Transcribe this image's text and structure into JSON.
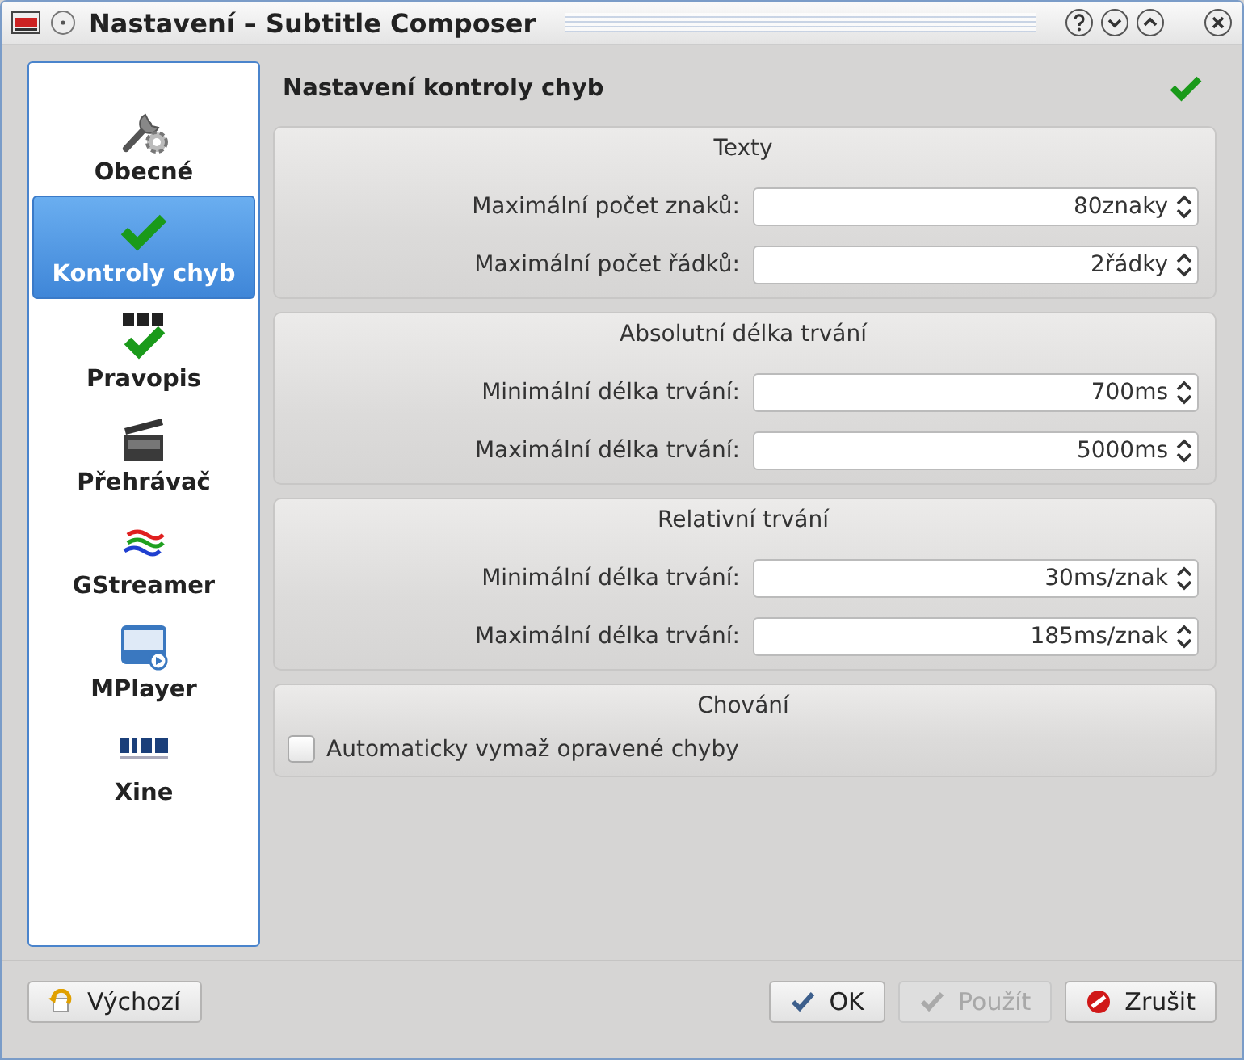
{
  "window": {
    "title": "Nastavení – Subtitle Composer"
  },
  "sidebar": {
    "items": [
      {
        "label": "Obecné",
        "kind": "tools",
        "selected": false
      },
      {
        "label": "Kontroly chyb",
        "kind": "check",
        "selected": true
      },
      {
        "label": "Pravopis",
        "kind": "spelling",
        "selected": false
      },
      {
        "label": "Přehrávač",
        "kind": "clapper",
        "selected": false
      },
      {
        "label": "GStreamer",
        "kind": "waves",
        "selected": false
      },
      {
        "label": "MPlayer",
        "kind": "screen",
        "selected": false
      },
      {
        "label": "Xine",
        "kind": "blocks",
        "selected": false
      }
    ]
  },
  "page": {
    "title": "Nastavení kontroly chyb"
  },
  "groups": [
    {
      "title": "Texty",
      "rows": [
        {
          "kind": "spinbox",
          "label": "Maximální počet znaků:",
          "value": "80znaky"
        },
        {
          "kind": "spinbox",
          "label": "Maximální počet řádků:",
          "value": "2řádky"
        }
      ]
    },
    {
      "title": "Absolutní délka trvání",
      "rows": [
        {
          "kind": "spinbox",
          "label": "Minimální délka trvání:",
          "value": "700ms"
        },
        {
          "kind": "spinbox",
          "label": "Maximální délka trvání:",
          "value": "5000ms"
        }
      ]
    },
    {
      "title": "Relativní trvání",
      "rows": [
        {
          "kind": "spinbox",
          "label": "Minimální délka trvání:",
          "value": "30ms/znak"
        },
        {
          "kind": "spinbox",
          "label": "Maximální délka trvání:",
          "value": "185ms/znak"
        }
      ]
    },
    {
      "title": "Chování",
      "rows": [
        {
          "kind": "checkbox",
          "label": "Automaticky vymaž opravené chyby",
          "checked": false
        }
      ]
    }
  ],
  "buttons": [
    {
      "label": "Výchozí",
      "kind": "defaults",
      "disabled": false
    },
    {
      "label": "OK",
      "kind": "ok",
      "disabled": false
    },
    {
      "label": "Použít",
      "kind": "apply",
      "disabled": true
    },
    {
      "label": "Zrušit",
      "kind": "cancel",
      "disabled": false
    }
  ]
}
